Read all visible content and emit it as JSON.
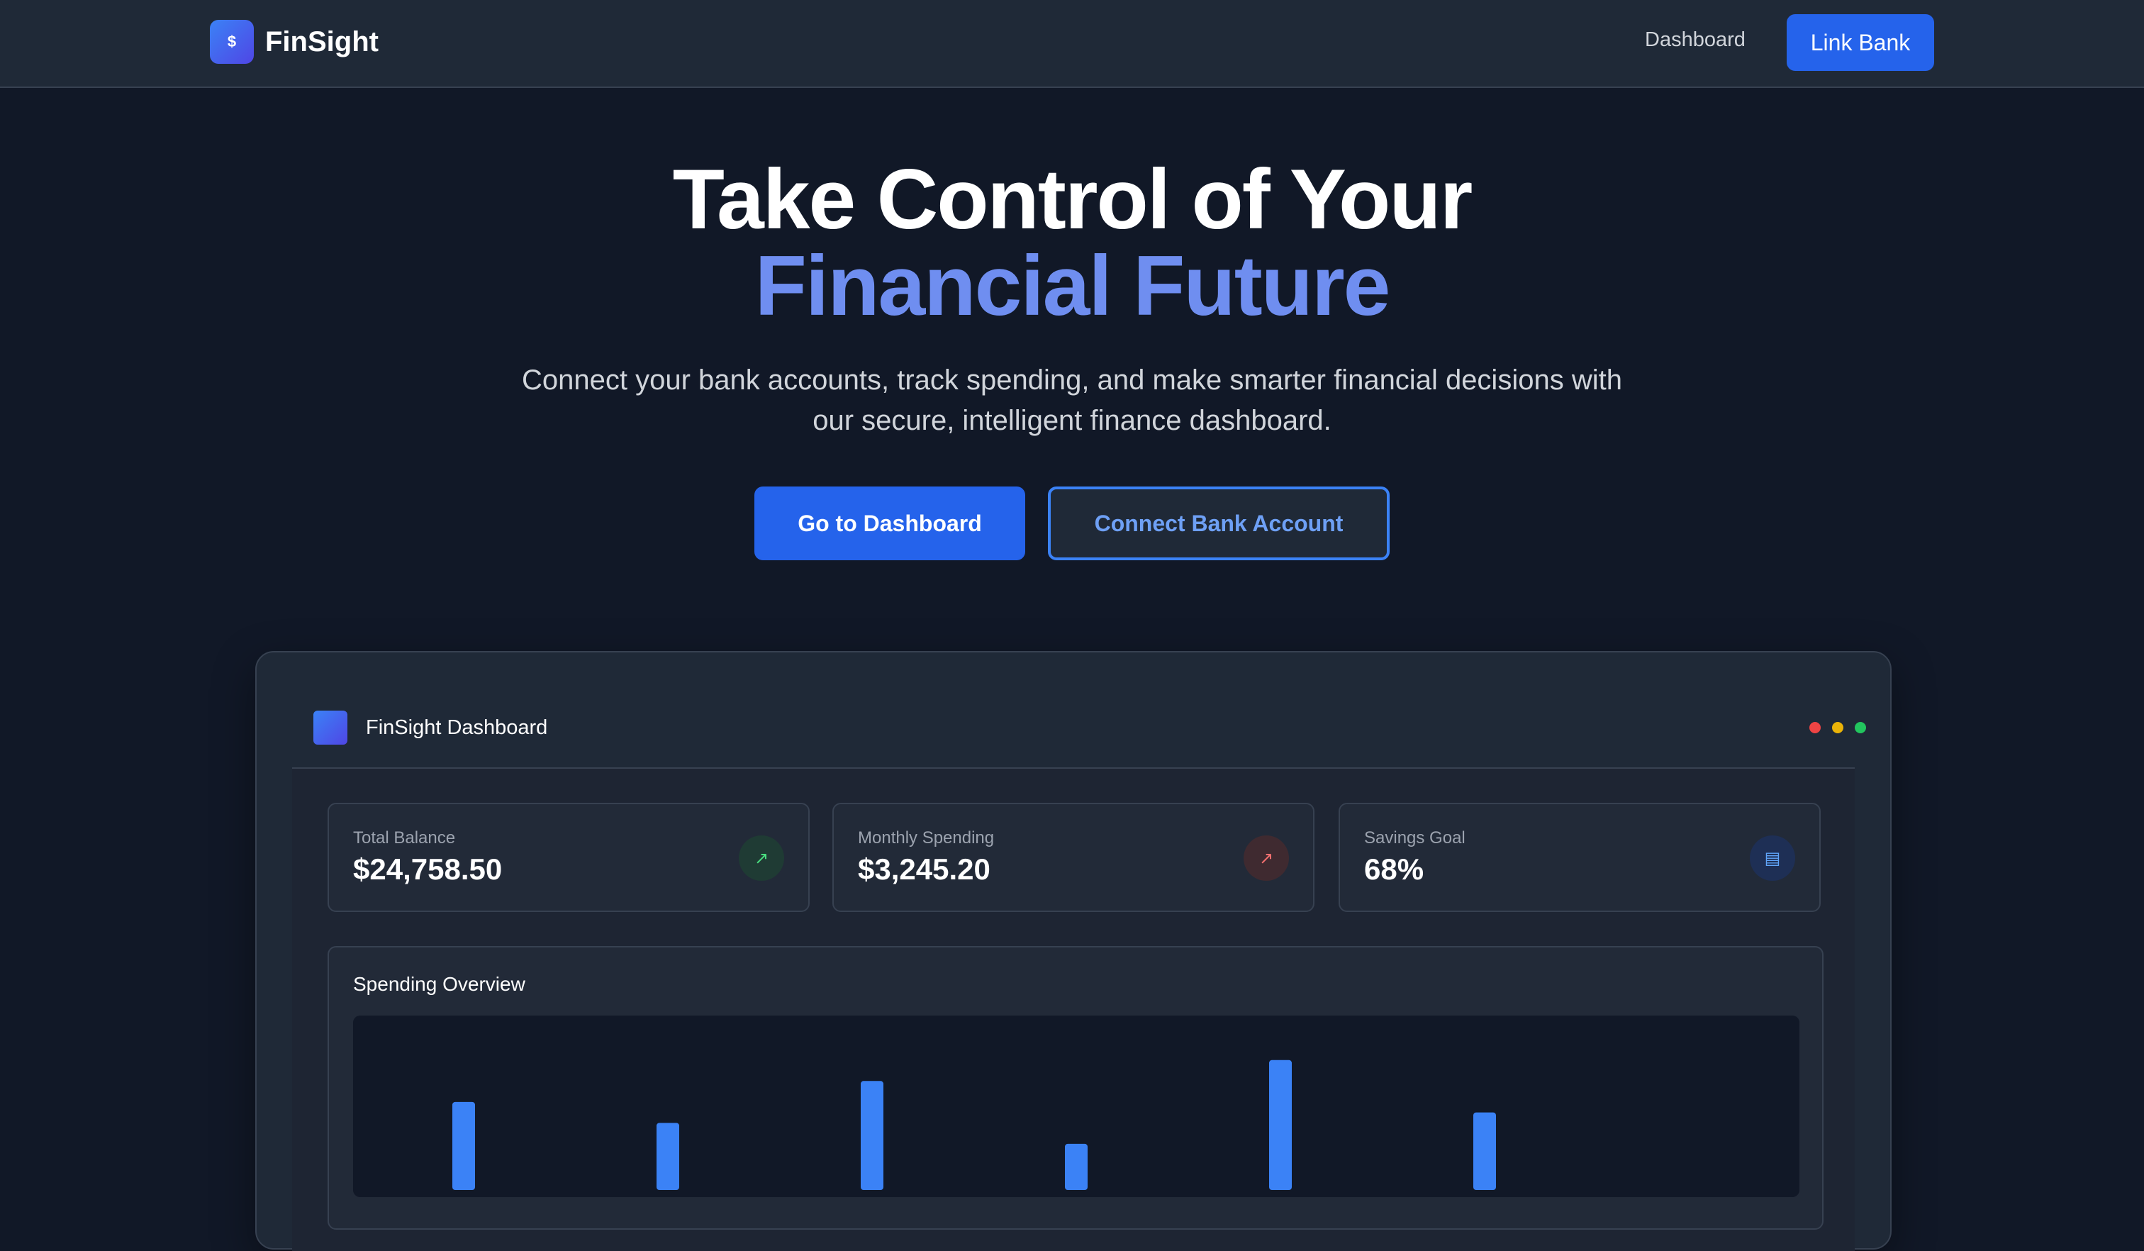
{
  "header": {
    "logo_symbol": "$",
    "brand": "FinSight",
    "nav_dashboard": "Dashboard",
    "link_bank": "Link Bank"
  },
  "hero": {
    "title_line1": "Take Control of Your",
    "title_line2": "Financial Future",
    "subtitle": "Connect your bank accounts, track spending, and make smarter financial decisions with our secure, intelligent finance dashboard.",
    "primary_cta": "Go to Dashboard",
    "secondary_cta": "Connect Bank Account"
  },
  "preview": {
    "title": "FinSight Dashboard",
    "stats": [
      {
        "label": "Total Balance",
        "value": "$24,758.50",
        "icon": "trend-up-icon"
      },
      {
        "label": "Monthly Spending",
        "value": "$3,245.20",
        "icon": "trend-up-icon"
      },
      {
        "label": "Savings Goal",
        "value": "68%",
        "icon": "document-icon"
      }
    ],
    "chart_title": "Spending Overview"
  },
  "colors": {
    "background": "#111827",
    "surface": "#1f2937",
    "accent": "#2563eb",
    "accent_text": "#6f8ef0",
    "bar": "#3b82f6"
  },
  "chart_data": {
    "type": "bar",
    "title": "Spending Overview",
    "values": [
      40,
      30,
      50,
      20,
      60,
      35
    ],
    "ylim": [
      0,
      65
    ],
    "grid": false,
    "legend": "none"
  }
}
